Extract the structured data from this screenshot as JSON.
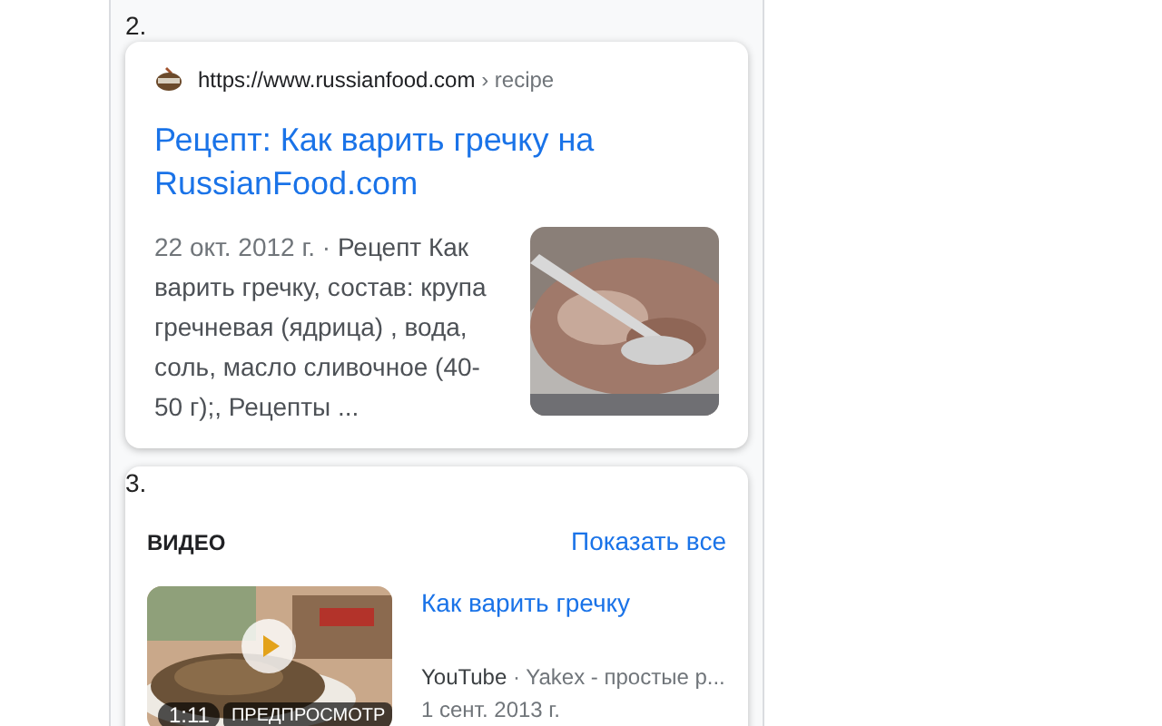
{
  "results": [
    {
      "kind": "web",
      "number": "2.",
      "url": "https://www.russianfood.com",
      "breadcrumb": "› recipe",
      "title": "Рецепт: Как варить гречку на RussianFood.com",
      "date": "22 окт. 2012 г. ·",
      "snippet": "Рецепт Как варить гречку, состав: крупа гречневая (ядрица) , вода, соль, масло сливочное (40-50 г);, Рецепты ..."
    },
    {
      "kind": "video",
      "number": "3.",
      "heading": "ВИДЕО",
      "show_all": "Показать все",
      "video": {
        "title": "Как варить гречку",
        "duration": "1:11",
        "preview": "ПРЕДПРОСМОТР",
        "source": "YouTube",
        "channel": "· Yakex - простые р...",
        "date": "1 сент. 2013 г."
      }
    }
  ]
}
